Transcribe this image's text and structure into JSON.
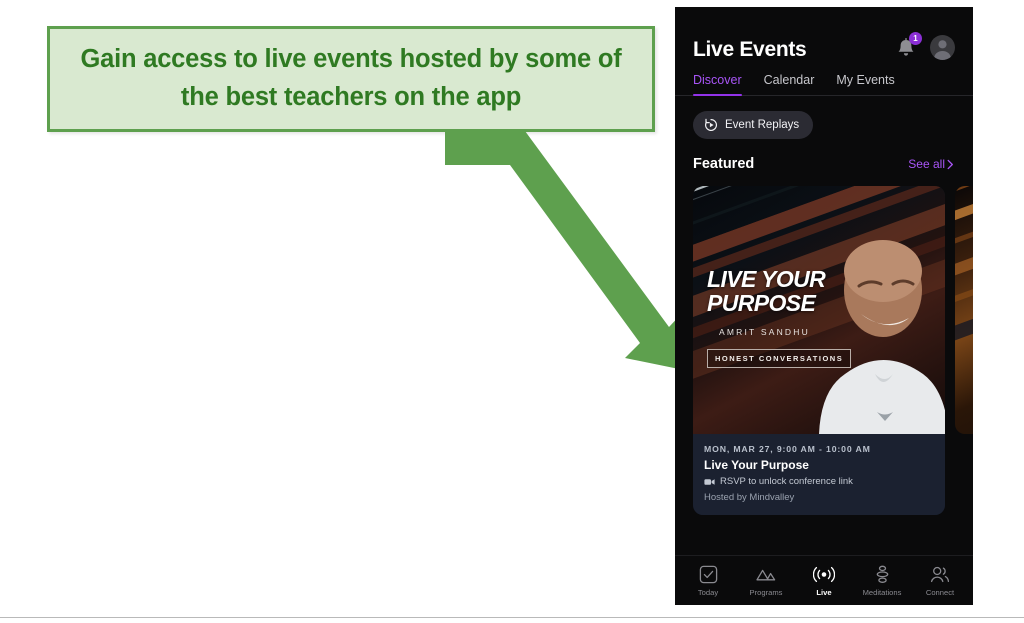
{
  "callout": {
    "text": "Gain access to live events hosted by some of the best teachers on the app",
    "fill_color": "#d9e9d0",
    "border_color": "#5ea04e",
    "text_color": "#2f7a22",
    "arrow_color": "#5ea04e"
  },
  "app": {
    "header": {
      "title": "Live Events",
      "notification_count": "1",
      "bell_icon": "bell-icon",
      "avatar_icon": "avatar-icon",
      "badge_color": "#8b2fd6"
    },
    "tabs": [
      {
        "label": "Discover",
        "active": true
      },
      {
        "label": "Calendar",
        "active": false
      },
      {
        "label": "My Events",
        "active": false
      }
    ],
    "accent_color": "#a855f7",
    "replays_chip": {
      "label": "Event Replays",
      "icon": "replay-icon"
    },
    "featured": {
      "title": "Featured",
      "see_all_label": "See all",
      "chevron_icon": "chevron-right-icon"
    },
    "event_card": {
      "art_title_line1": "LIVE YOUR",
      "art_title_line2": "PURPOSE",
      "art_presenter": "AMRIT SANDHU",
      "art_badge": "HONEST CONVERSATIONS",
      "date": "MON, MAR 27, 9:00 AM - 10:00 AM",
      "name": "Live Your Purpose",
      "rsvp": "RSVP to unlock conference link",
      "rsvp_icon": "video-camera-icon",
      "host": "Hosted by Mindvalley"
    },
    "bottom_nav": [
      {
        "label": "Today",
        "icon": "checkbox-icon",
        "active": false
      },
      {
        "label": "Programs",
        "icon": "mountains-icon",
        "active": false
      },
      {
        "label": "Live",
        "icon": "broadcast-icon",
        "active": true
      },
      {
        "label": "Meditations",
        "icon": "stones-icon",
        "active": false
      },
      {
        "label": "Connect",
        "icon": "people-icon",
        "active": false
      }
    ]
  }
}
